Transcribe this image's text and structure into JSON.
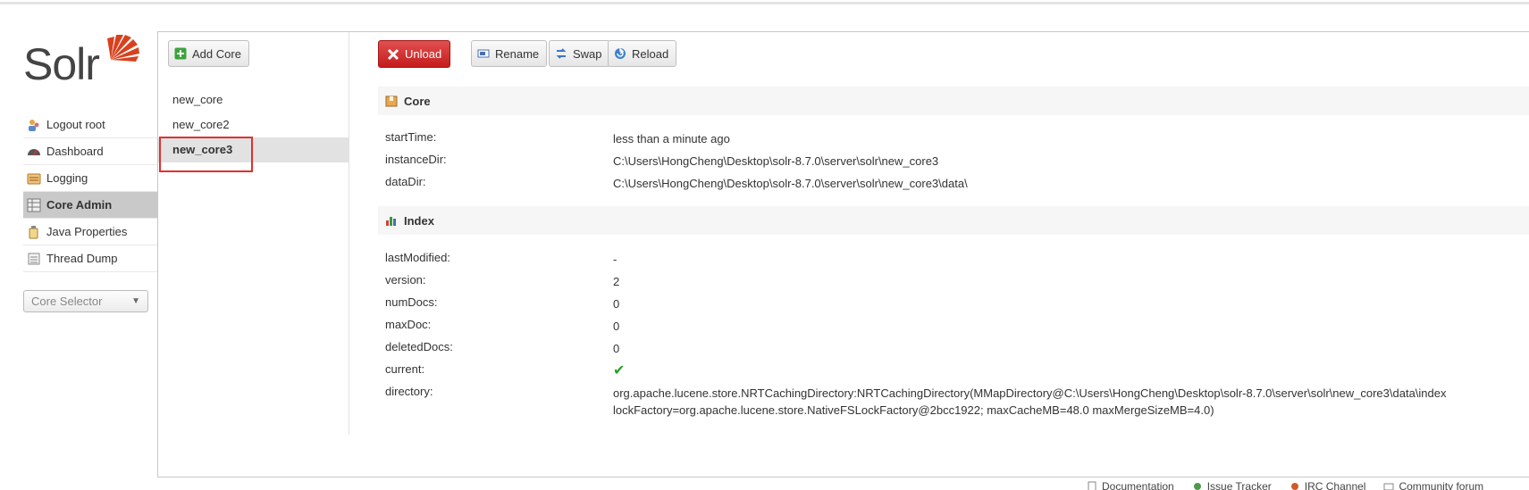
{
  "logo": {
    "text": "Solr",
    "color": "#d9411e"
  },
  "nav": {
    "items": [
      {
        "label": "Logout root",
        "icon": "user-icon"
      },
      {
        "label": "Dashboard",
        "icon": "dashboard-icon"
      },
      {
        "label": "Logging",
        "icon": "logging-icon"
      },
      {
        "label": "Core Admin",
        "icon": "core-admin-icon",
        "active": true
      },
      {
        "label": "Java Properties",
        "icon": "java-icon"
      },
      {
        "label": "Thread Dump",
        "icon": "thread-dump-icon"
      }
    ],
    "core_selector": "Core Selector"
  },
  "cores": {
    "add_label": "Add Core",
    "list": [
      "new_core",
      "new_core2",
      "new_core3"
    ],
    "selected": "new_core3"
  },
  "toolbar": {
    "unload": "Unload",
    "rename": "Rename",
    "swap": "Swap",
    "reload": "Reload"
  },
  "core_section": {
    "title": "Core",
    "rows": [
      {
        "key": "startTime:",
        "value": "less than a minute ago"
      },
      {
        "key": "instanceDir:",
        "value": "C:\\Users\\HongCheng\\Desktop\\solr-8.7.0\\server\\solr\\new_core3"
      },
      {
        "key": "dataDir:",
        "value": "C:\\Users\\HongCheng\\Desktop\\solr-8.7.0\\server\\solr\\new_core3\\data\\"
      }
    ]
  },
  "index_section": {
    "title": "Index",
    "rows": [
      {
        "key": "lastModified:",
        "value": "-"
      },
      {
        "key": "version:",
        "value": "2"
      },
      {
        "key": "numDocs:",
        "value": "0"
      },
      {
        "key": "maxDoc:",
        "value": "0"
      },
      {
        "key": "deletedDocs:",
        "value": "0"
      },
      {
        "key": "current:",
        "value": "✔"
      },
      {
        "key": "directory:",
        "value": "org.apache.lucene.store.NRTCachingDirectory:NRTCachingDirectory(MMapDirectory@C:\\Users\\HongCheng\\Desktop\\solr-8.7.0\\server\\solr\\new_core3\\data\\index lockFactory=org.apache.lucene.store.NativeFSLockFactory@2bcc1922; maxCacheMB=48.0 maxMergeSizeMB=4.0)"
      }
    ]
  },
  "footer": {
    "links": [
      "Documentation",
      "Issue Tracker",
      "IRC Channel",
      "Community forum"
    ]
  }
}
